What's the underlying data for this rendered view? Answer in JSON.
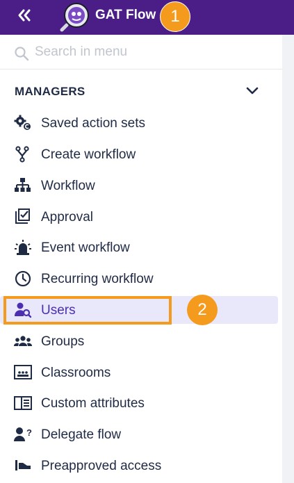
{
  "header": {
    "collapse_icon": "double-chevron-left-icon",
    "logo_icon": "gat-flow-logo-icon",
    "title": "GAT Flow",
    "callout_1": "1",
    "background": "#4a1e86"
  },
  "search": {
    "placeholder": "Search in menu",
    "icon": "search-icon"
  },
  "section": {
    "title": "MANAGERS",
    "toggle_icon": "chevron-down-icon"
  },
  "menu": {
    "items": [
      {
        "label": "Saved action sets",
        "icon": "gears-icon"
      },
      {
        "label": "Create workflow",
        "icon": "fork-icon"
      },
      {
        "label": "Workflow",
        "icon": "sitemap-icon"
      },
      {
        "label": "Approval",
        "icon": "approval-check-icon"
      },
      {
        "label": "Event workflow",
        "icon": "siren-icon"
      },
      {
        "label": "Recurring workflow",
        "icon": "clock-icon"
      },
      {
        "label": "Users",
        "icon": "user-search-icon",
        "active": true
      },
      {
        "label": "Groups",
        "icon": "groups-icon"
      },
      {
        "label": "Classrooms",
        "icon": "classroom-icon"
      },
      {
        "label": "Custom attributes",
        "icon": "attributes-icon"
      },
      {
        "label": "Delegate flow",
        "icon": "user-question-icon"
      },
      {
        "label": "Preapproved access",
        "icon": "preapproved-icon"
      }
    ]
  },
  "callout_2": "2",
  "colors": {
    "accent": "#f49a1c",
    "active_bg": "#e9e8fb",
    "active_text": "#4b2fb0"
  }
}
